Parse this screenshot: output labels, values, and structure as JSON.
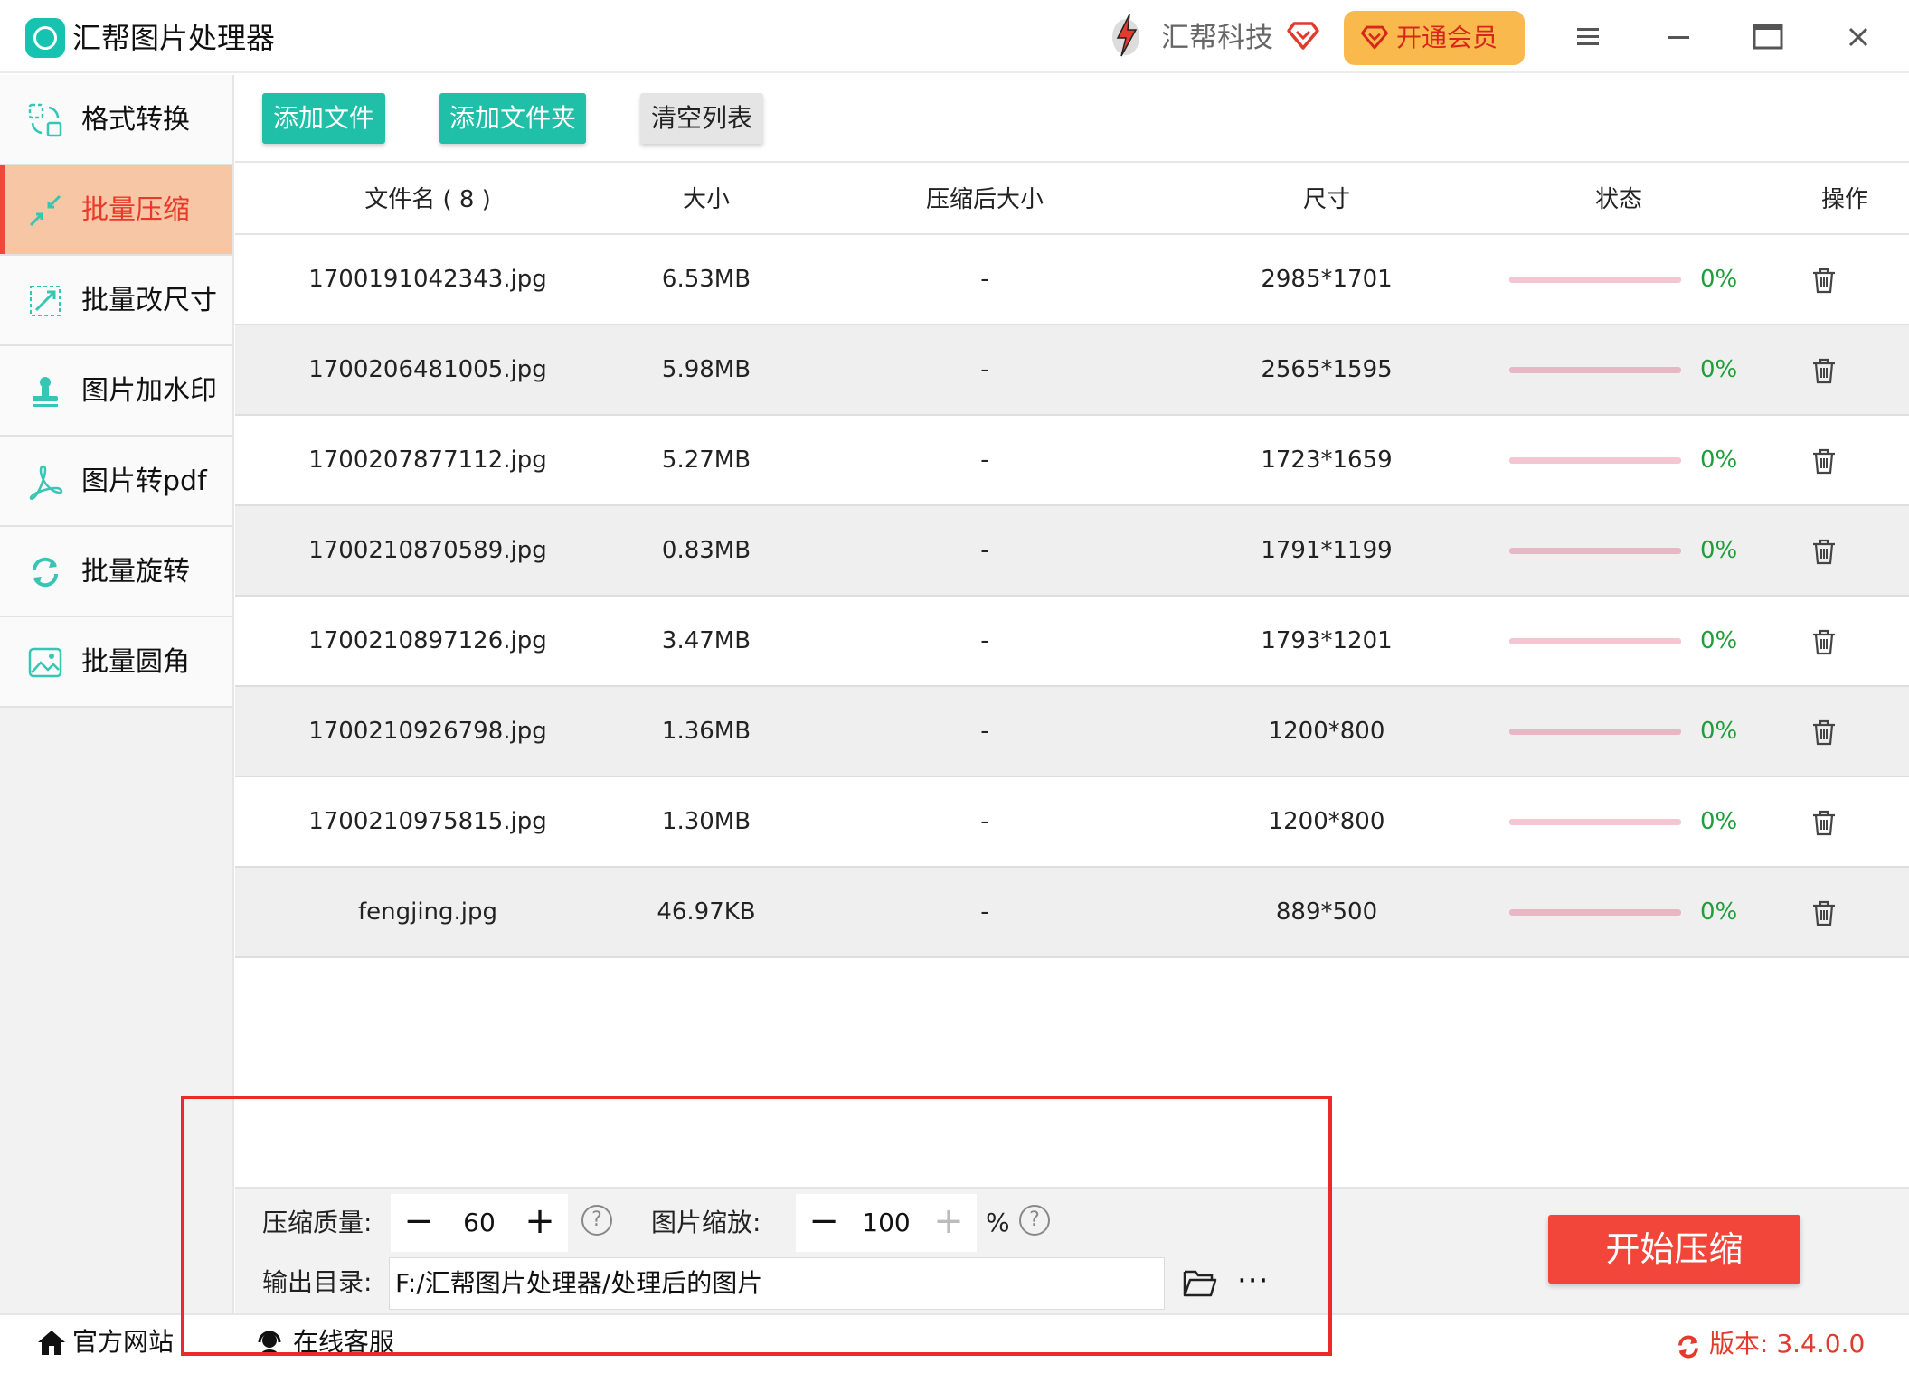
{
  "app": {
    "title": "汇帮图片处理器",
    "brand": "汇帮科技",
    "vip_label": "开通会员",
    "accent_color": "#1fbfa8",
    "active_color": "#e83a2b",
    "icons": {
      "logo": "app-logo-icon",
      "brand": "brand-lightning-icon",
      "heart": "diamond-heart-icon",
      "menu": "hamburger-menu-icon",
      "minimize": "minimize-icon",
      "maximize": "maximize-icon",
      "close": "close-icon"
    }
  },
  "sidebar": {
    "items": [
      {
        "label": "格式转换",
        "icon": "format-convert-icon",
        "active": false
      },
      {
        "label": "批量压缩",
        "icon": "compress-icon",
        "active": true
      },
      {
        "label": "批量改尺寸",
        "icon": "resize-icon",
        "active": false
      },
      {
        "label": "图片加水印",
        "icon": "watermark-icon",
        "active": false
      },
      {
        "label": "图片转pdf",
        "icon": "pdf-icon",
        "active": false
      },
      {
        "label": "批量旋转",
        "icon": "rotate-icon",
        "active": false
      },
      {
        "label": "批量圆角",
        "icon": "rounded-corner-icon",
        "active": false
      }
    ]
  },
  "toolbar": {
    "add_file": "添加文件",
    "add_folder": "添加文件夹",
    "clear_list": "清空列表"
  },
  "table": {
    "headers": {
      "name": "文件名 ( 8 )",
      "size": "大小",
      "compressed_size": "压缩后大小",
      "dimensions": "尺寸",
      "status": "状态",
      "action": "操作"
    },
    "rows": [
      {
        "name": "1700191042343.jpg",
        "size": "6.53MB",
        "compressed": "-",
        "dim": "2985*1701",
        "progress": 0,
        "pct": "0%"
      },
      {
        "name": "1700206481005.jpg",
        "size": "5.98MB",
        "compressed": "-",
        "dim": "2565*1595",
        "progress": 0,
        "pct": "0%"
      },
      {
        "name": "1700207877112.jpg",
        "size": "5.27MB",
        "compressed": "-",
        "dim": "1723*1659",
        "progress": 0,
        "pct": "0%"
      },
      {
        "name": "1700210870589.jpg",
        "size": "0.83MB",
        "compressed": "-",
        "dim": "1791*1199",
        "progress": 0,
        "pct": "0%"
      },
      {
        "name": "1700210897126.jpg",
        "size": "3.47MB",
        "compressed": "-",
        "dim": "1793*1201",
        "progress": 0,
        "pct": "0%"
      },
      {
        "name": "1700210926798.jpg",
        "size": "1.36MB",
        "compressed": "-",
        "dim": "1200*800",
        "progress": 0,
        "pct": "0%"
      },
      {
        "name": "1700210975815.jpg",
        "size": "1.30MB",
        "compressed": "-",
        "dim": "1200*800",
        "progress": 0,
        "pct": "0%"
      },
      {
        "name": "fengjing.jpg",
        "size": "46.97KB",
        "compressed": "-",
        "dim": "889*500",
        "progress": 0,
        "pct": "0%"
      }
    ]
  },
  "settings": {
    "quality_label": "压缩质量:",
    "quality_value": "60",
    "scale_label": "图片缩放:",
    "scale_value": "100",
    "scale_unit": "%",
    "output_label": "输出目录:",
    "output_path": "F:/汇帮图片处理器/处理后的图片",
    "more_label": "···",
    "help_glyph": "?",
    "minus_glyph": "−",
    "plus_glyph": "+"
  },
  "start_button": "开始压缩",
  "footer": {
    "website": "官方网站",
    "support": "在线客服",
    "version": "版本: 3.4.0.0"
  }
}
